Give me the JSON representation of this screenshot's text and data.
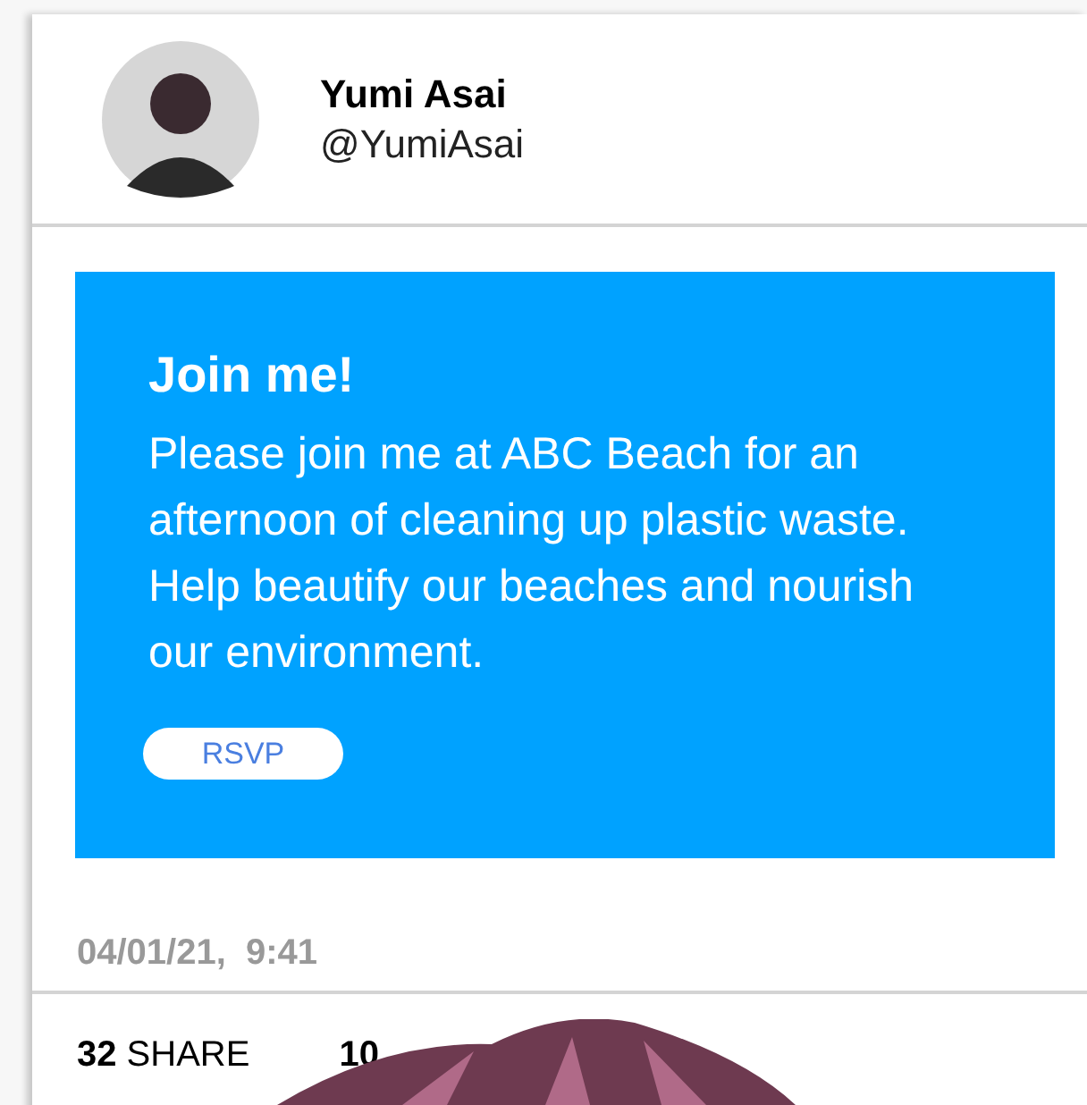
{
  "profile": {
    "name": "Yumi Asai",
    "handle": "@YumiAsai"
  },
  "invite": {
    "title": "Join me!",
    "body": "Please join me at ABC Beach for an afternoon of cleaning up plastic waste. Help beautify our beaches and nourish our environment.",
    "button": "RSVP"
  },
  "timestamp": "04/01/21,  9:41",
  "stats": [
    {
      "count": "32",
      "label": "SHARE"
    },
    {
      "count": "10"
    }
  ]
}
